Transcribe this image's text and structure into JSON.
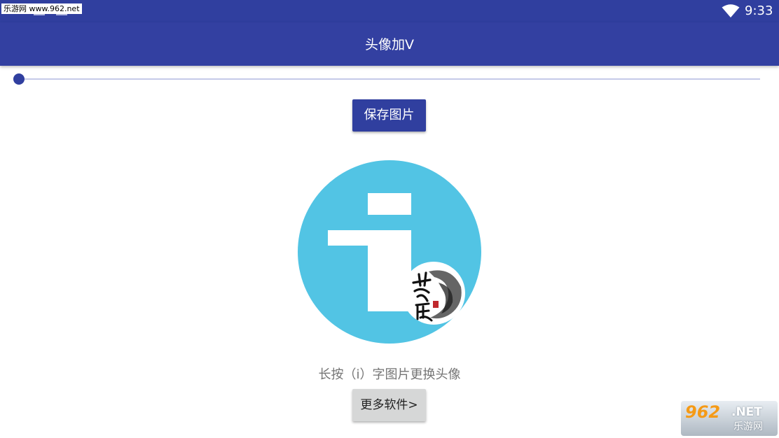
{
  "status_bar": {
    "watermark": "乐游网 www.962.net",
    "time": "9:33",
    "wifi_icon": "wifi-icon",
    "color": "#303f9f"
  },
  "app_bar": {
    "title": "头像加V",
    "color": "#3340a1"
  },
  "seekbar": {
    "progress": 0,
    "accent": "#303f9f",
    "track": "#c5cae9"
  },
  "save_button": {
    "label": "保存图片"
  },
  "avatar": {
    "icon": "info-i-icon",
    "circle_color": "#52c4e4",
    "badge_icon": "su-chen-calligraphy-badge",
    "badge_text": "苏晨"
  },
  "hint": {
    "text": "长按（i）字图片更换头像"
  },
  "more_button": {
    "label": "更多软件>"
  },
  "corner_watermark": {
    "number": "962",
    "domain": ".NET",
    "site": "乐游网"
  }
}
